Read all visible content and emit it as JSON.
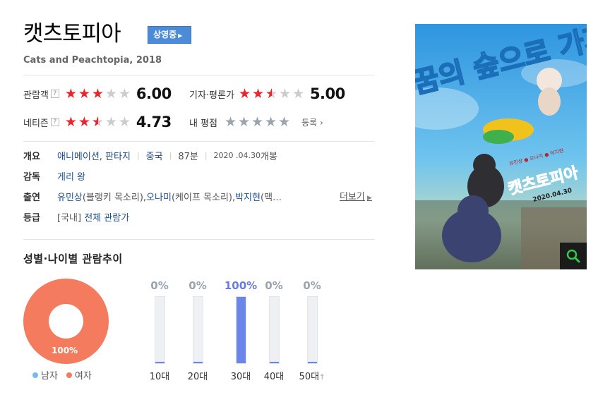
{
  "movie": {
    "title": "캣츠토피아",
    "badge": "상영중",
    "subtitle": "Cats and Peachtopia, 2018"
  },
  "ratings": {
    "audience": {
      "label": "관람객",
      "help": "?",
      "stars": 3,
      "score": "6.00"
    },
    "critic": {
      "label": "기자·평론가",
      "stars": 2.5,
      "score": "5.00"
    },
    "netizen": {
      "label": "네티즌",
      "help": "?",
      "stars": 2.5,
      "score": "4.73"
    },
    "mine": {
      "label": "내 평점",
      "register_label": "등록"
    }
  },
  "info": {
    "overview_label": "개요",
    "genre": "애니메이션, 판타지",
    "country": "중국",
    "runtime": "87분",
    "release_date": "2020 .04.30",
    "release_suffix": "개봉",
    "director_label": "감독",
    "director": "게리 왕",
    "cast_label": "출연",
    "cast_1_name": "유민상",
    "cast_1_role": "(블랭키 목소리), ",
    "cast_2_name": "오나미",
    "cast_2_role": "(케이프 목소리), ",
    "cast_3_name": "박지현",
    "cast_3_role": "(맥…",
    "more_label": "더보기",
    "grade_label": "등급",
    "grade_region": "[국내]",
    "grade": "전체 관람가"
  },
  "demographics": {
    "title": "성별·나이별 관람추이",
    "female_pct_label": "100%",
    "legend_male": "남자",
    "legend_female": "여자",
    "colors": {
      "male": "#7ab8ef",
      "female": "#f47b5d",
      "bar": "#6b85e8"
    },
    "ages": [
      {
        "label": "10대",
        "pct_label": "0%",
        "value": 0
      },
      {
        "label": "20대",
        "pct_label": "0%",
        "value": 0
      },
      {
        "label": "30대",
        "pct_label": "100%",
        "value": 100
      },
      {
        "label": "40대",
        "pct_label": "0%",
        "value": 0
      },
      {
        "label": "50대",
        "pct_label": "0%",
        "value": 0
      }
    ]
  },
  "poster": {
    "headline": "꿈의 숲으로 가자",
    "title": "캣츠토피아",
    "voice_cast": "유민상 ● 오나미 ● 박지현",
    "date": "2020.04.30"
  }
}
